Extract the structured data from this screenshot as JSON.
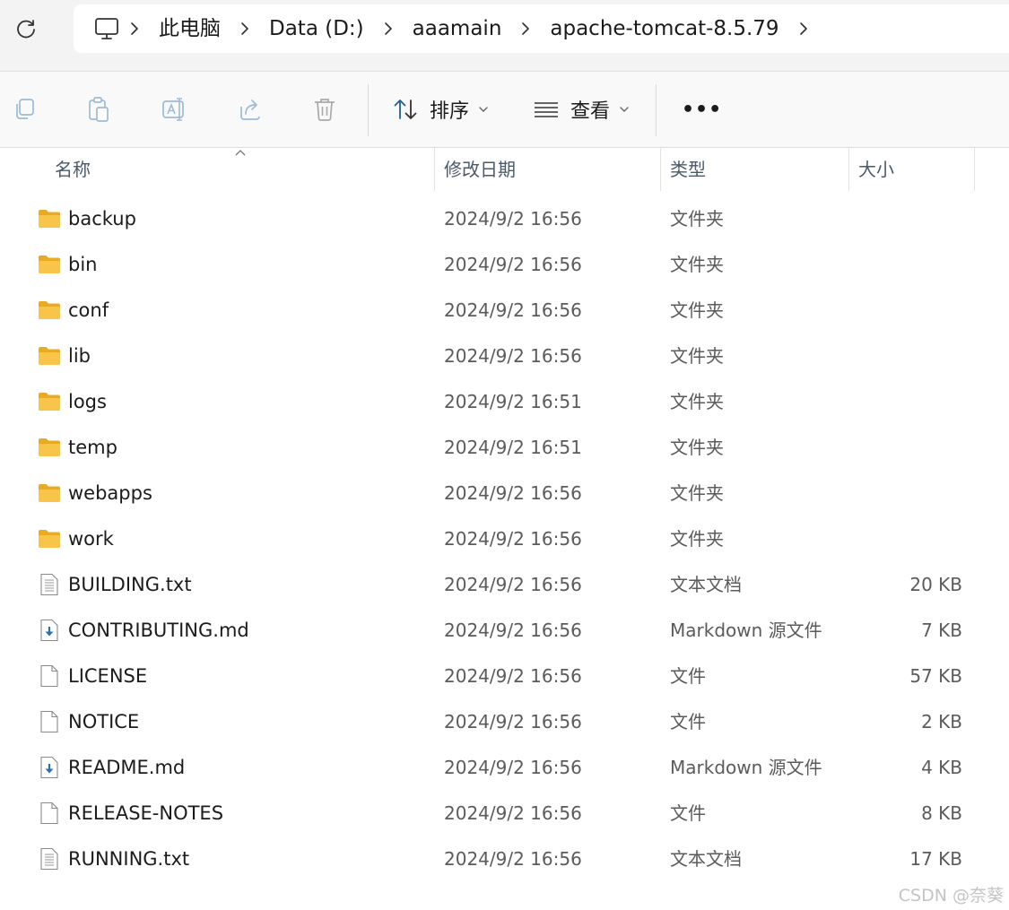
{
  "address": {
    "breadcrumbs": [
      "此电脑",
      "Data (D:)",
      "aaamain",
      "apache-tomcat-8.5.79"
    ]
  },
  "toolbar": {
    "icons": [
      "copy-icon",
      "paste-icon",
      "rename-icon",
      "share-icon",
      "delete-icon"
    ],
    "sort_label": "排序",
    "view_label": "查看",
    "more_label": "•••"
  },
  "columns": {
    "name": "名称",
    "date": "修改日期",
    "type": "类型",
    "size": "大小"
  },
  "files": [
    {
      "name": "backup",
      "date": "2024/9/2 16:56",
      "type": "文件夹",
      "size": "",
      "icon": "folder"
    },
    {
      "name": "bin",
      "date": "2024/9/2 16:56",
      "type": "文件夹",
      "size": "",
      "icon": "folder"
    },
    {
      "name": "conf",
      "date": "2024/9/2 16:56",
      "type": "文件夹",
      "size": "",
      "icon": "folder"
    },
    {
      "name": "lib",
      "date": "2024/9/2 16:56",
      "type": "文件夹",
      "size": "",
      "icon": "folder"
    },
    {
      "name": "logs",
      "date": "2024/9/2 16:51",
      "type": "文件夹",
      "size": "",
      "icon": "folder"
    },
    {
      "name": "temp",
      "date": "2024/9/2 16:51",
      "type": "文件夹",
      "size": "",
      "icon": "folder"
    },
    {
      "name": "webapps",
      "date": "2024/9/2 16:56",
      "type": "文件夹",
      "size": "",
      "icon": "folder"
    },
    {
      "name": "work",
      "date": "2024/9/2 16:56",
      "type": "文件夹",
      "size": "",
      "icon": "folder"
    },
    {
      "name": "BUILDING.txt",
      "date": "2024/9/2 16:56",
      "type": "文本文档",
      "size": "20 KB",
      "icon": "text"
    },
    {
      "name": "CONTRIBUTING.md",
      "date": "2024/9/2 16:56",
      "type": "Markdown 源文件",
      "size": "7 KB",
      "icon": "markdown"
    },
    {
      "name": "LICENSE",
      "date": "2024/9/2 16:56",
      "type": "文件",
      "size": "57 KB",
      "icon": "file"
    },
    {
      "name": "NOTICE",
      "date": "2024/9/2 16:56",
      "type": "文件",
      "size": "2 KB",
      "icon": "file"
    },
    {
      "name": "README.md",
      "date": "2024/9/2 16:56",
      "type": "Markdown 源文件",
      "size": "4 KB",
      "icon": "markdown"
    },
    {
      "name": "RELEASE-NOTES",
      "date": "2024/9/2 16:56",
      "type": "文件",
      "size": "8 KB",
      "icon": "file"
    },
    {
      "name": "RUNNING.txt",
      "date": "2024/9/2 16:56",
      "type": "文本文档",
      "size": "17 KB",
      "icon": "text"
    }
  ],
  "watermark": "CSDN @奈葵",
  "colors": {
    "folder": "#f8c44a",
    "folder_dark": "#e9ab21",
    "accent": "#0067c0"
  }
}
